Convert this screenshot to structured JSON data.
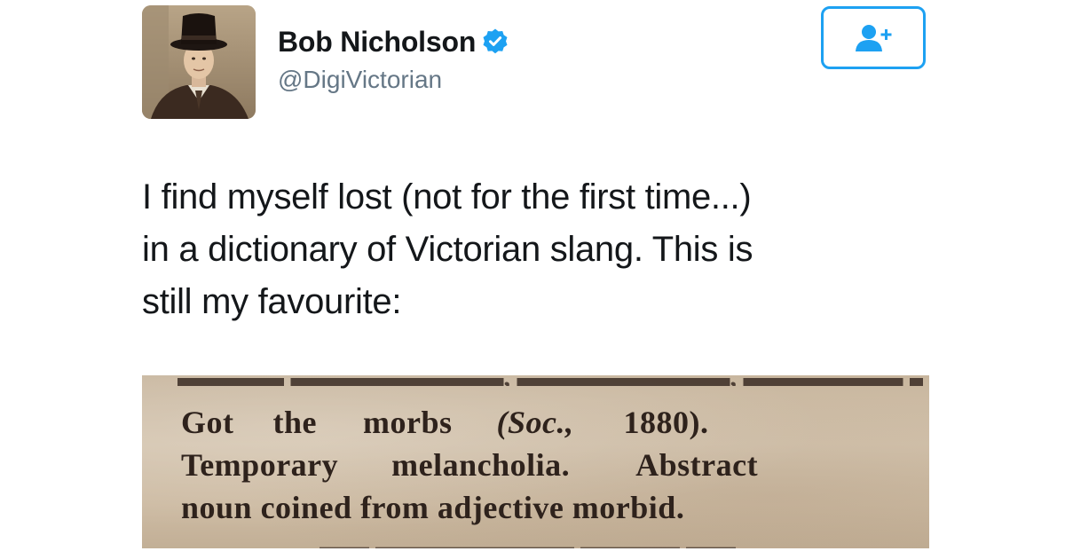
{
  "profile": {
    "display_name": "Bob Nicholson",
    "handle": "@DigiVictorian",
    "verified": true,
    "avatar_icon": "avatar-top-hat-portrait"
  },
  "actions": {
    "follow_icon": "add-user-icon"
  },
  "tweet": {
    "lines": [
      "I find myself lost (not for the first time...)",
      "in a dictionary of Victorian slang. This is",
      "still my favourite:"
    ]
  },
  "media": {
    "scan_line_1": {
      "w1": "Got",
      "w2": "the",
      "w3": "morbs",
      "w4": "(Soc.,",
      "w5": "1880)."
    },
    "scan_line_2": {
      "w1": "Temporary",
      "w2": "melancholia.",
      "w3": "Abstract"
    },
    "scan_line_3": "noun coined from adjective morbid."
  },
  "colors": {
    "accent": "#1da1f2",
    "text_primary": "#14171a",
    "text_secondary": "#657786",
    "paper": "#cdbba3",
    "ink": "#2e221c"
  }
}
